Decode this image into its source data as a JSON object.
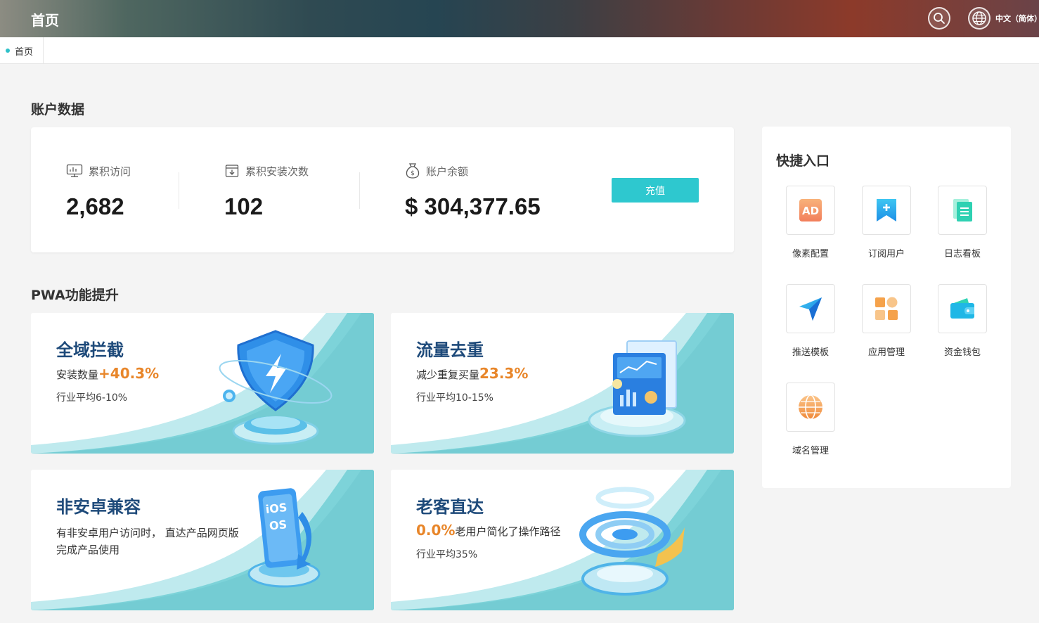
{
  "header": {
    "title": "首页",
    "language": "中文（简体）"
  },
  "tabs": [
    {
      "label": "首页",
      "active": true
    }
  ],
  "account": {
    "section_title": "账户数据",
    "stats": [
      {
        "label": "累积访问",
        "value": "2,682",
        "icon": "monitor-icon"
      },
      {
        "label": "累积安装次数",
        "value": "102",
        "icon": "download-box-icon"
      },
      {
        "label": "账户余额",
        "value": "$ 304,377.65",
        "icon": "money-bag-icon"
      }
    ],
    "recharge_label": "充值"
  },
  "pwa": {
    "section_title": "PWA功能提升",
    "cards": [
      {
        "title": "全域拦截",
        "line1_text": "安装数量",
        "line1_accent": "+40.3%",
        "line2": "行业平均6-10%",
        "illustration": "shield-icon"
      },
      {
        "title": "流量去重",
        "line1_text": "减少重复买量",
        "line1_accent": "23.3%",
        "line2": "行业平均10-15%",
        "illustration": "chart-panel-icon"
      },
      {
        "title": "非安卓兼容",
        "description": "有非安卓用户访问时， 直达产品网页版完成产品使用",
        "illustration": "ios-phone-icon"
      },
      {
        "title": "老客直达",
        "line1_accent": "0.0%",
        "line1_text": "老用户简化了操作路径",
        "line2": "行业平均35%",
        "illustration": "rings-icon"
      }
    ]
  },
  "quick": {
    "title": "快捷入口",
    "items": [
      {
        "label": "像素配置",
        "icon": "ad-icon"
      },
      {
        "label": "订阅用户",
        "icon": "bookmark-plus-icon"
      },
      {
        "label": "日志看板",
        "icon": "document-icon"
      },
      {
        "label": "推送模板",
        "icon": "paper-plane-icon"
      },
      {
        "label": "应用管理",
        "icon": "apps-grid-icon"
      },
      {
        "label": "资金钱包",
        "icon": "wallet-icon"
      },
      {
        "label": "域名管理",
        "icon": "globe-icon"
      }
    ]
  },
  "colors": {
    "accent": "#2ec8cf",
    "highlight": "#e8862a",
    "feature_title": "#1e4a7a"
  }
}
